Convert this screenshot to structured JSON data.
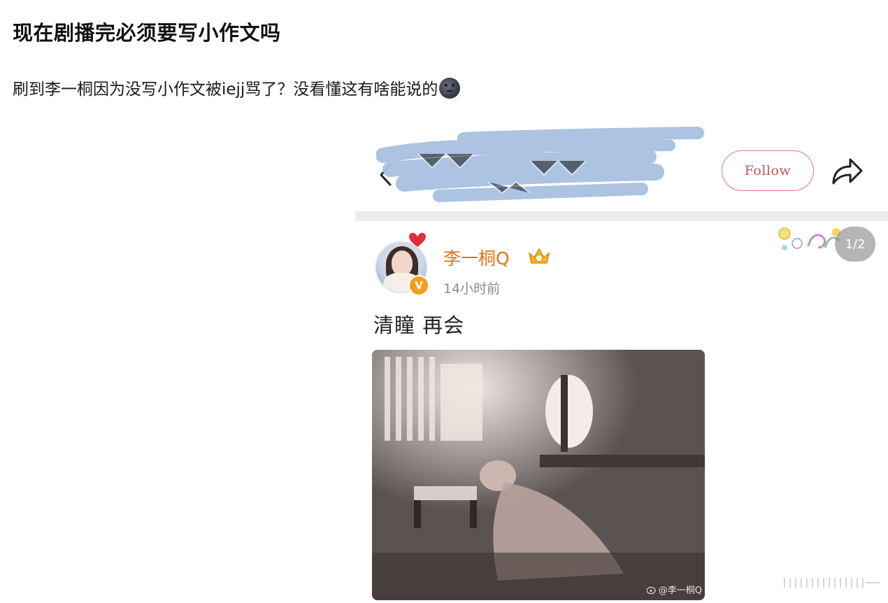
{
  "post": {
    "title": "现在剧播完必须要写小作文吗",
    "body": "刷到李一桐因为没写小作文被iejj骂了？没看懂这有啥能说的",
    "emoji": "new-moon-face-icon"
  },
  "embedded": {
    "header": {
      "follow_label": "Follow",
      "back_icon": "chevron-left-icon",
      "share_icon": "share-arrow-icon"
    },
    "weibo": {
      "username": "李一桐Q",
      "timestamp": "14小时前",
      "text": "清瞳 再会",
      "page_indicator": "1/2",
      "watermark": "@李一桐Q",
      "verified_mark": "V"
    }
  },
  "colors": {
    "username": "#e3741a",
    "follow_border": "#d57a7e",
    "scribble": "#a8c0e0",
    "verified": "#f29e1e"
  }
}
